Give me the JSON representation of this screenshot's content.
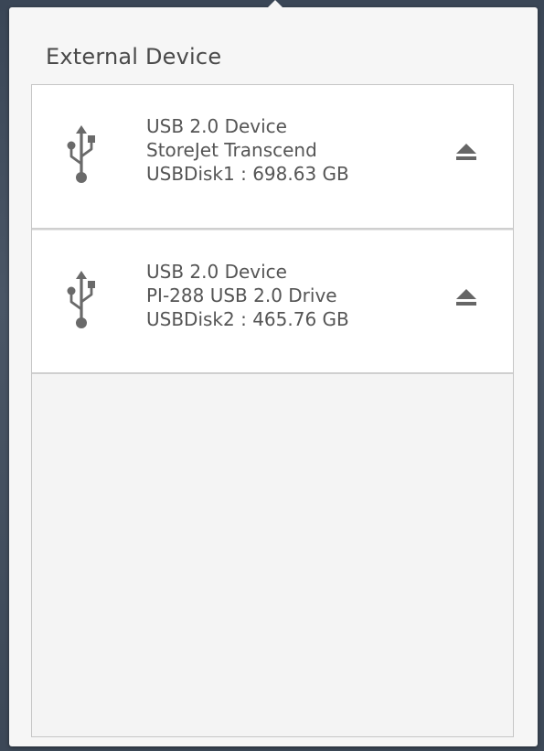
{
  "panel": {
    "title": "External Device"
  },
  "devices": [
    {
      "type": "USB 2.0 Device",
      "model": "StoreJet Transcend",
      "disk": "USBDisk1 : 698.63 GB",
      "icon": "usb-icon",
      "action_icon": "eject-icon"
    },
    {
      "type": "USB 2.0 Device",
      "model": "PI-288 USB 2.0 Drive",
      "disk": "USBDisk2 : 465.76 GB",
      "icon": "usb-icon",
      "action_icon": "eject-icon"
    }
  ],
  "colors": {
    "panel_bg": "#f6f6f6",
    "item_bg": "#ffffff",
    "text": "#555555",
    "border": "#c6c6c6",
    "icon": "#666666"
  }
}
